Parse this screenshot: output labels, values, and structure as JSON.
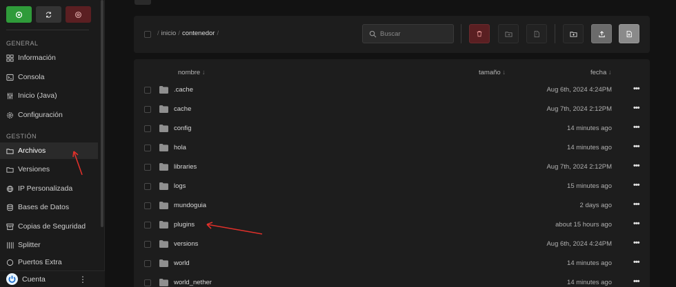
{
  "sidebar": {
    "power_buttons": [
      {
        "name": "start",
        "icon": "power-icon",
        "color": "#2f9b3a"
      },
      {
        "name": "restart",
        "icon": "restart-icon",
        "color": "#343434"
      },
      {
        "name": "stop",
        "icon": "stop-icon",
        "color": "#5b1f22"
      }
    ],
    "sections": {
      "general": "GENERAL",
      "gestion": "GESTIÓN"
    },
    "items": [
      {
        "label": "Información",
        "icon": "grid-icon"
      },
      {
        "label": "Consola",
        "icon": "terminal-icon"
      },
      {
        "label": "Inicio (Java)",
        "icon": "sliders-icon"
      },
      {
        "label": "Configuración",
        "icon": "gear-icon"
      },
      {
        "label": "Archivos",
        "icon": "folder-icon"
      },
      {
        "label": "Versiones",
        "icon": "folder-icon"
      },
      {
        "label": "IP Personalizada",
        "icon": "globe-icon"
      },
      {
        "label": "Bases de Datos",
        "icon": "database-icon"
      },
      {
        "label": "Copias de Seguridad",
        "icon": "archive-icon"
      },
      {
        "label": "Splitter",
        "icon": "splitter-icon"
      },
      {
        "label": "Puertos Extra",
        "icon": "plug-icon"
      }
    ],
    "active_item": "Archivos",
    "footer": {
      "label": "Cuenta"
    }
  },
  "toolbar": {
    "breadcrumb": [
      "inicio",
      "contenedor"
    ],
    "search_placeholder": "Buscar"
  },
  "table": {
    "columns": {
      "name": "nombre",
      "size": "tamaño",
      "date": "fecha"
    },
    "rows": [
      {
        "name": ".cache",
        "date": "Aug 6th, 2024 4:24PM"
      },
      {
        "name": "cache",
        "date": "Aug 7th, 2024 2:12PM"
      },
      {
        "name": "config",
        "date": "14 minutes ago"
      },
      {
        "name": "hola",
        "date": "14 minutes ago"
      },
      {
        "name": "libraries",
        "date": "Aug 7th, 2024 2:12PM"
      },
      {
        "name": "logs",
        "date": "15 minutes ago"
      },
      {
        "name": "mundoguia",
        "date": "2 days ago"
      },
      {
        "name": "plugins",
        "date": "about 15 hours ago"
      },
      {
        "name": "versions",
        "date": "Aug 6th, 2024 4:24PM"
      },
      {
        "name": "world",
        "date": "14 minutes ago"
      },
      {
        "name": "world_nether",
        "date": "14 minutes ago"
      }
    ]
  },
  "colors": {
    "accent_green": "#2f9b3a",
    "danger": "#5a1f22",
    "annotation_arrow": "#e0302a"
  }
}
